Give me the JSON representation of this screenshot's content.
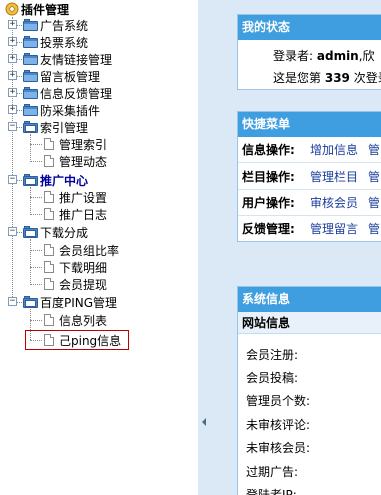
{
  "tree": {
    "root_label": "插件管理",
    "items": [
      {
        "label": "广告系统",
        "expanded": false
      },
      {
        "label": "投票系统",
        "expanded": false
      },
      {
        "label": "友情链接管理",
        "expanded": false
      },
      {
        "label": "留言板管理",
        "expanded": false
      },
      {
        "label": "信息反馈管理",
        "expanded": false
      },
      {
        "label": "防采集插件",
        "expanded": false
      },
      {
        "label": "索引管理",
        "expanded": true,
        "children": [
          "管理索引",
          "管理动态"
        ]
      },
      {
        "label": "推广中心",
        "expanded": true,
        "children": [
          "推广设置",
          "推广日志"
        ]
      },
      {
        "label": "下载分成",
        "expanded": true,
        "children": [
          "会员组比率",
          "下载明细",
          "会员提现"
        ]
      },
      {
        "label": "百度PING管理",
        "expanded": true,
        "children": [
          "信息列表",
          "己ping信息"
        ]
      }
    ],
    "selected": "己ping信息"
  },
  "status": {
    "title": "我的状态",
    "login_prefix": "登录者:",
    "user": "admin",
    "login_suffix": ",欣",
    "visit_prefix": "这是您第",
    "visit_count": "339",
    "visit_suffix": "次登录"
  },
  "quick": {
    "title": "快捷菜单",
    "rows": [
      {
        "label": "信息操作:",
        "link1": "增加信息",
        "link2": "管"
      },
      {
        "label": "栏目操作:",
        "link1": "管理栏目",
        "link2": "管"
      },
      {
        "label": "用户操作:",
        "link1": "审核会员",
        "link2": "管"
      },
      {
        "label": "反馈管理:",
        "link1": "管理留言",
        "link2": "管"
      }
    ]
  },
  "sysinfo": {
    "title": "系统信息",
    "subtitle": "网站信息",
    "rows": [
      "会员注册:",
      "会员投稿:",
      "管理员个数:",
      "未审核评论:",
      "未审核会员:",
      "过期广告:",
      "登陆者IP:"
    ]
  }
}
